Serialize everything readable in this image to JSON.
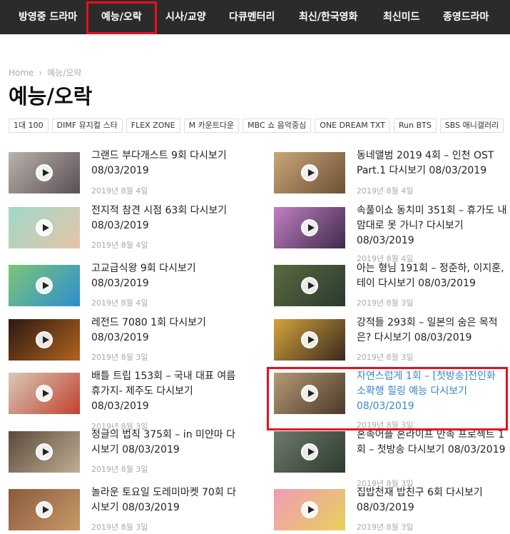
{
  "nav": {
    "items": [
      "방영중 드라마",
      "예능/오락",
      "시사/교양",
      "다큐멘터리",
      "최신/한국영화",
      "최신미드",
      "종영드라마"
    ]
  },
  "breadcrumb": {
    "home": "Home",
    "separator": "›",
    "current": "예능/오락"
  },
  "page_title": "예능/오락",
  "tags": [
    "1대 100",
    "DIMF 뮤지컬 스타",
    "FLEX ZONE",
    "M 카운트다운",
    "MBC 쇼 음악중심",
    "ONE DREAM TXT",
    "Run BTS",
    "SBS 애니갤러리"
  ],
  "posts_left": [
    {
      "title": "그랜드 부다개스트 9회 다시보기 08/03/2019",
      "date": "2019년 8월 4일",
      "thumb_colors": [
        "#b9b2ac",
        "#5a4f55"
      ]
    },
    {
      "title": "전지적 참견 시점 63회 다시보기 08/03/2019",
      "date": "2019년 8월 4일",
      "thumb_colors": [
        "#9ed9c9",
        "#e6c4a8"
      ]
    },
    {
      "title": "고교급식왕 9회 다시보기 08/03/2019",
      "date": "2019년 8월 4일",
      "thumb_colors": [
        "#7cc576",
        "#2e8fd0"
      ]
    },
    {
      "title": "레전드 7080 1회 다시보기 08/03/2019",
      "date": "2019년 8월 3일",
      "thumb_colors": [
        "#2b1a12",
        "#b2631e"
      ]
    },
    {
      "title": "배틀 트립 153회 – 국내 대표 여름 휴가지- 제주도 다시보기 08/03/2019",
      "date": "2019년 8월 3일",
      "thumb_colors": [
        "#d8c9b8",
        "#c2412f"
      ]
    },
    {
      "title": "정글의 법칙 375회 – in 미얀마 다시보기 08/03/2019",
      "date": "2019년 8월 3일",
      "thumb_colors": [
        "#5b4a3c",
        "#bfae92"
      ]
    },
    {
      "title": "놀라운 토요일 도레미마켓 70회 다시보기 08/03/2019",
      "date": "2019년 8월 3일",
      "thumb_colors": [
        "#8a5a3e",
        "#c79a67"
      ]
    }
  ],
  "posts_right": [
    {
      "title": "동네앨범 2019 4회 – 인천 OST Part.1 다시보기 08/03/2019",
      "date": "2019년 8월 4일",
      "thumb_colors": [
        "#c9a779",
        "#6e5036"
      ]
    },
    {
      "title": "속풀이쇼 동치미 351회 – 휴가도 내 맘대로 못 가니? 다시보기 08/03/2019",
      "date": "2019년 8월 4일",
      "thumb_colors": [
        "#c27fc4",
        "#3e2a4a"
      ]
    },
    {
      "title": "아는 형님 191회 – 정준하, 이지훈, 테이 다시보기 08/03/2019",
      "date": "2019년 8월 3일",
      "thumb_colors": [
        "#5c6a3e",
        "#2a3a2e"
      ]
    },
    {
      "title": "강적들 293회 – 일본의 숨은 목적은? 다시보기 08/03/2019",
      "date": "2019년 8월 3일",
      "thumb_colors": [
        "#d3a43a",
        "#3a2a1e"
      ]
    },
    {
      "title": "자연스럽게 1회 – [첫방송]전인화 소확행 힐링 예능 다시보기 08/03/2019",
      "date": "2019년 8월 3일",
      "thumb_colors": [
        "#b49a76",
        "#4b3a28"
      ]
    },
    {
      "title": "혼족어플 혼라이프 만족 프로젝트 1회 – 첫방송 다시보기 08/03/2019",
      "date": "2019년 8월 3일",
      "thumb_colors": [
        "#6d7a6a",
        "#2d3a30"
      ]
    },
    {
      "title": "집밥천재 밥친구 6회 다시보기 08/03/2019",
      "date": "2019년 8월 3일",
      "thumb_colors": [
        "#f29ab8",
        "#e6d25a"
      ]
    }
  ],
  "accent_color": "#3a87c8",
  "highlight_color": "#e8101f"
}
